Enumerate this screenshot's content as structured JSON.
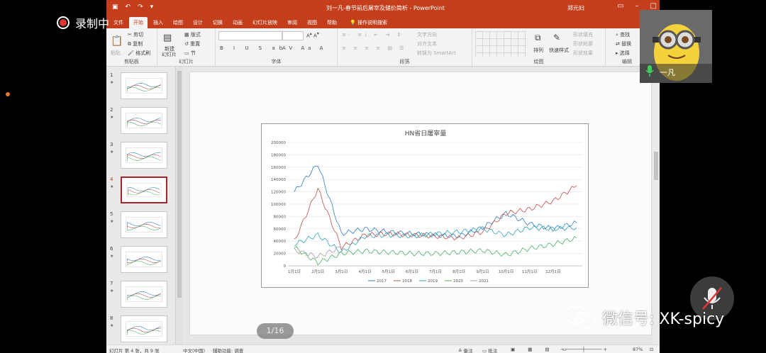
{
  "recording": {
    "label": "录制中"
  },
  "window": {
    "title": "刘一凡-春节前后屠宰及储价简析 - PowerPoint",
    "user": "郑元妇"
  },
  "tabs": [
    "文件",
    "开始",
    "插入",
    "绘图",
    "设计",
    "切换",
    "动画",
    "幻灯片放映",
    "审阅",
    "视图",
    "帮助"
  ],
  "tell_me": "操作说明搜索",
  "ribbon": {
    "clipboard": {
      "paste": "粘贴",
      "cut": "剪切",
      "copy": "复制",
      "format_painter": "格式刷",
      "label": "剪贴板"
    },
    "slides": {
      "new_slide": "新建",
      "new_slide2": "幻灯片",
      "layout": "版式",
      "reset": "重置",
      "section": "节",
      "label": "幻灯片"
    },
    "font": {
      "label": "字体"
    },
    "paragraph": {
      "text_direction": "文字方向",
      "align_text": "对齐文本",
      "smartart": "转换为 SmartArt",
      "label": "段落"
    },
    "drawing": {
      "arrange": "排列",
      "quick_styles": "快速样式",
      "shape_fill": "形状填充",
      "shape_outline": "形状轮廓",
      "shape_effects": "形状效果",
      "label": "绘图"
    },
    "editing": {
      "find": "查找",
      "replace": "替换",
      "select": "选择",
      "label": "编辑"
    }
  },
  "thumbnails": [
    {
      "num": "1",
      "selected": false
    },
    {
      "num": "2",
      "selected": false
    },
    {
      "num": "3",
      "selected": false
    },
    {
      "num": "4",
      "selected": true
    },
    {
      "num": "5",
      "selected": false
    },
    {
      "num": "6",
      "selected": false
    },
    {
      "num": "7",
      "selected": false
    },
    {
      "num": "8",
      "selected": false
    }
  ],
  "pager": "1/16",
  "status": {
    "slide_info": "幻灯片 第 4 张，共 9 张",
    "language": "中文(中国)",
    "accessibility": "辅助功能: 调查",
    "notes": "备注",
    "comments": "批注",
    "zoom": "87%"
  },
  "camera": {
    "name": "一凡"
  },
  "watermark": {
    "text": "微信号: XK-spicy"
  },
  "colors": {
    "accent": "#c43e1c",
    "s2017": "#2f7ec4",
    "s2018": "#c0504d",
    "s2019": "#2fa3b8",
    "s2020": "#4cae67",
    "s2021": "#a0a0a0"
  },
  "chart_data": {
    "type": "line",
    "title": "HN省日屠宰量",
    "x": [
      "1月1日",
      "2月1日",
      "3月1日",
      "4月1日",
      "5月1日",
      "6月1日",
      "7月1日",
      "8月1日",
      "9月1日",
      "10月1日",
      "11月1日",
      "12月1日"
    ],
    "ylim": [
      0,
      200000
    ],
    "yticks": [
      0,
      20000,
      40000,
      60000,
      80000,
      100000,
      120000,
      140000,
      160000,
      180000,
      200000
    ],
    "legend": "bottom",
    "series": [
      {
        "name": "2017",
        "values": [
          120000,
          165000,
          52000,
          60000,
          55000,
          52000,
          50000,
          48000,
          62000,
          85000,
          68000,
          60000,
          70000
        ]
      },
      {
        "name": "2018",
        "values": [
          40000,
          125000,
          30000,
          50000,
          52000,
          50000,
          48000,
          45000,
          55000,
          85000,
          92000,
          105000,
          130000
        ]
      },
      {
        "name": "2019",
        "values": [
          35000,
          50000,
          22000,
          48000,
          50000,
          48000,
          52000,
          55000,
          60000,
          50000,
          62000,
          60000,
          62000
        ]
      },
      {
        "name": "2020",
        "values": [
          30000,
          5000,
          20000,
          24000,
          22000,
          20000,
          20000,
          22000,
          25000,
          18000,
          28000,
          35000,
          45000
        ]
      },
      {
        "name": "2021",
        "values": [
          25000,
          15000,
          30000
        ]
      }
    ]
  }
}
